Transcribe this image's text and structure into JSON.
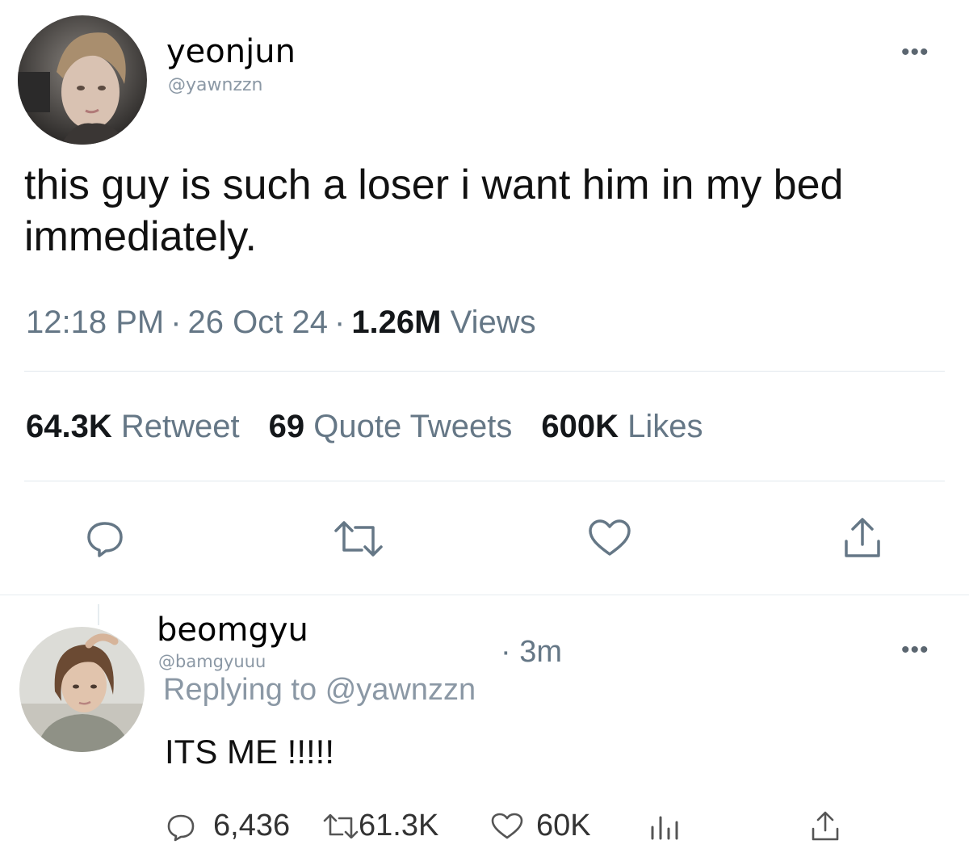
{
  "tweet": {
    "author": {
      "display_name": "yeonjun",
      "handle": "@yawnzzn"
    },
    "more_icon": "more-horizontal-icon",
    "text": "this guy is such a loser i want him in my bed immediately.",
    "time": "12:18 PM",
    "separator": "·",
    "date": "26 Oct 24",
    "views_count": "1.26M",
    "views_label": "Views",
    "stats": {
      "retweets_count": "64.3K",
      "retweets_label": "Retweet",
      "quotes_count": "69",
      "quotes_label": "Quote Tweets",
      "likes_count": "600K",
      "likes_label": "Likes"
    },
    "actions": [
      "reply-icon",
      "retweet-icon",
      "like-icon",
      "share-icon"
    ]
  },
  "reply": {
    "author": {
      "display_name": "beomgyu",
      "handle": "@bamgyuuu"
    },
    "time": "· 3m",
    "replying_to_label": "Replying to",
    "replying_to_handle": "@yawnzzn",
    "text": "ITS ME !!!!!",
    "counts": {
      "replies": "6,436",
      "retweets": "61.3K",
      "likes": "60K"
    },
    "actions": [
      "reply-icon",
      "retweet-icon",
      "like-icon",
      "analytics-icon",
      "share-icon"
    ]
  },
  "colors": {
    "text": "#14171a",
    "secondary": "#657786",
    "handle": "#8b98a5",
    "divider": "#e1e8ed",
    "icon": "#657786"
  }
}
